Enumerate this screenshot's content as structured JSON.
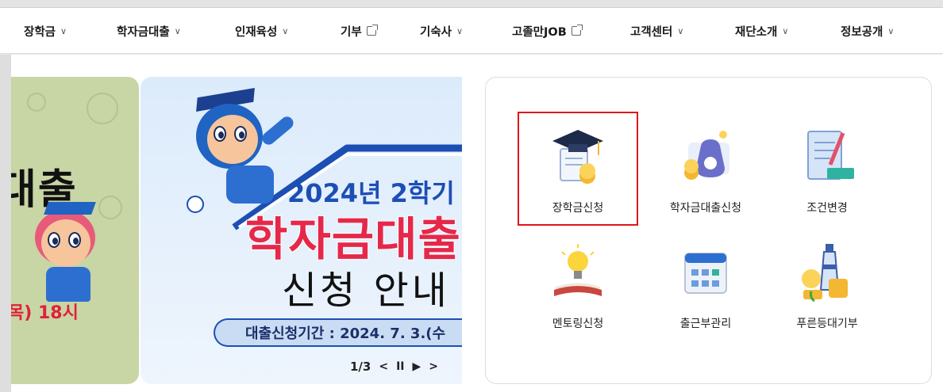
{
  "nav": {
    "items": [
      {
        "label": "장학금",
        "icon": "chevron-down-icon"
      },
      {
        "label": "학자금대출",
        "icon": "chevron-down-icon"
      },
      {
        "label": "인재육성",
        "icon": "chevron-down-icon"
      },
      {
        "label": "기부",
        "icon": "external-link-icon"
      },
      {
        "label": "기숙사",
        "icon": "chevron-down-icon"
      },
      {
        "label": "고졸만JOB",
        "icon": "external-link-icon"
      },
      {
        "label": "고객센터",
        "icon": "chevron-down-icon"
      },
      {
        "label": "재단소개",
        "icon": "chevron-down-icon"
      },
      {
        "label": "정보공개",
        "icon": "chevron-down-icon"
      }
    ]
  },
  "banner_prev": {
    "headline": "대출",
    "date_text": "목) 18시"
  },
  "banner_main": {
    "semester": "2024년 2학기",
    "title": "학자금대출",
    "subtitle": "신청 안내",
    "period": "대출신청기간 : 2024. 7. 3.(수"
  },
  "pager": {
    "current": "1/3",
    "prev_icon": "chevron-left-icon",
    "pause_icon": "pause-icon",
    "play_icon": "play-icon",
    "next_icon": "chevron-right-icon"
  },
  "services": [
    {
      "label": "장학금신청",
      "icon": "graduation-cap-icon"
    },
    {
      "label": "학자금대출신청",
      "icon": "money-bag-icon"
    },
    {
      "label": "조건변경",
      "icon": "document-edit-icon"
    },
    {
      "label": "멘토링신청",
      "icon": "lightbulb-book-icon"
    },
    {
      "label": "출근부관리",
      "icon": "calendar-icon"
    },
    {
      "label": "푸른등대기부",
      "icon": "lighthouse-coins-icon"
    }
  ],
  "colors": {
    "highlight": "#e1161b",
    "brand_blue": "#1c4fb4",
    "title_red": "#e5284a",
    "prev_banner_green": "#c8d5a4"
  }
}
